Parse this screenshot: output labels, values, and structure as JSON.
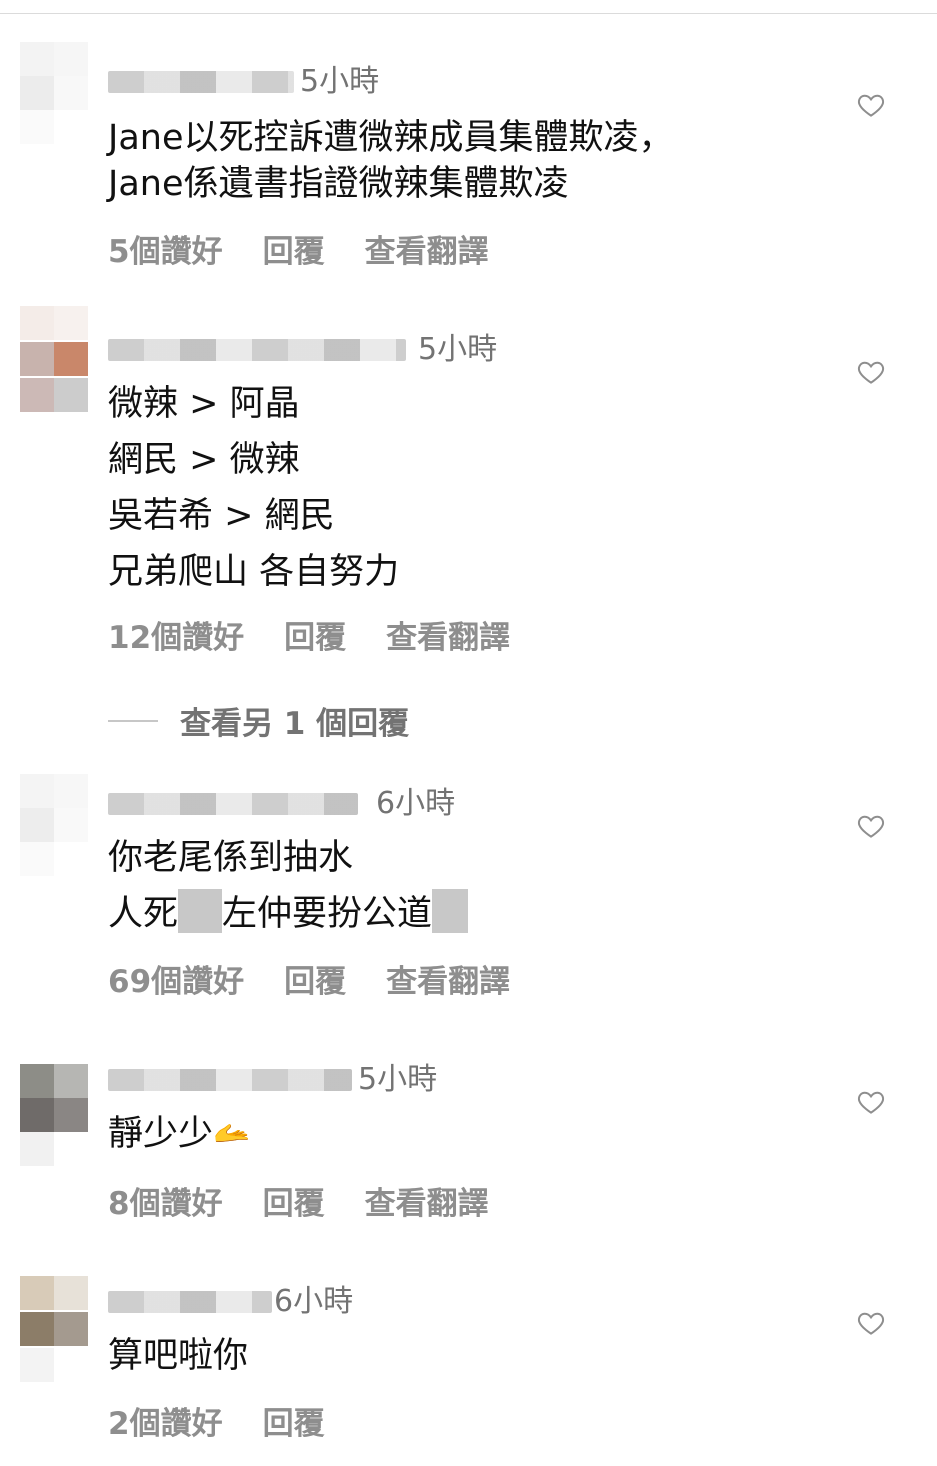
{
  "comments": [
    {
      "time": "5小時",
      "lines": [
        "Jane以死控訴遭微辣成員集體欺凌，",
        "Jane係遺書指證微辣集體欺凌"
      ],
      "likes": "5個讚好",
      "reply": "回覆",
      "translate": "查看翻譯"
    },
    {
      "time": "5小時",
      "lines": [
        "微辣 > 阿晶",
        "網民 > 微辣",
        "吳若希 > 網民",
        "兄弟爬山 各自努力"
      ],
      "likes": "12個讚好",
      "reply": "回覆",
      "translate": "查看翻譯",
      "view_replies": "查看另 1 個回覆"
    },
    {
      "time": "6小時",
      "lines": [
        "你老尾係到抽水",
        "人死",
        "左仲要扮公道"
      ],
      "likes": "69個讚好",
      "reply": "回覆",
      "translate": "查看翻譯"
    },
    {
      "time": "5小時",
      "lines": [
        "靜少少"
      ],
      "emoji": "🫴",
      "likes": "8個讚好",
      "reply": "回覆",
      "translate": "查看翻譯"
    },
    {
      "time": "6小時",
      "lines": [
        "算吧啦你"
      ],
      "likes": "2個讚好",
      "reply": "回覆"
    }
  ],
  "icons": {
    "like": "heart-outline-icon"
  },
  "colors": {
    "secondary_text": "#737373",
    "action_text": "#8e8e8e",
    "primary_text": "#111111"
  }
}
